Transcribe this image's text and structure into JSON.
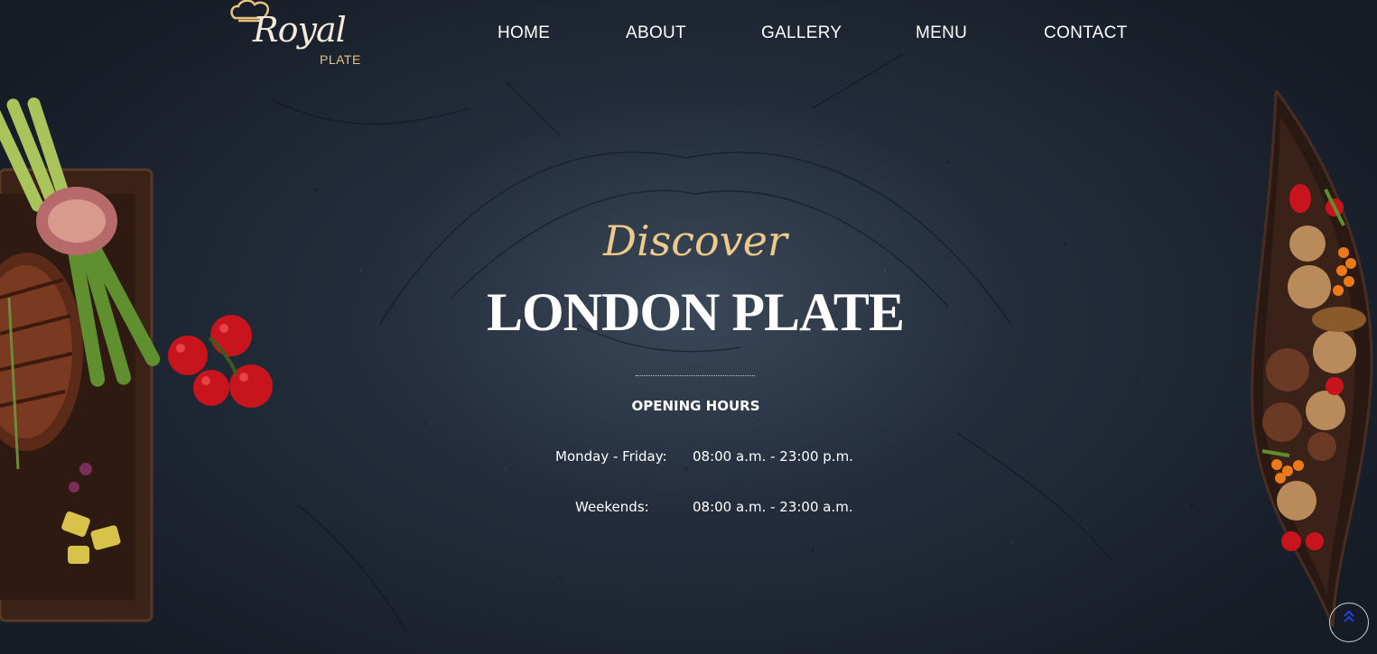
{
  "brand": {
    "script": "Royal",
    "sub": "PLATE",
    "accent_color": "#e9c27c"
  },
  "nav": {
    "items": [
      {
        "label": "HOME"
      },
      {
        "label": "ABOUT"
      },
      {
        "label": "GALLERY"
      },
      {
        "label": "MENU"
      },
      {
        "label": "CONTACT"
      }
    ]
  },
  "hero": {
    "eyebrow": "Discover",
    "title": "LONDON PLATE",
    "hours_title": "OPENING HOURS",
    "hours": [
      {
        "label": "Monday - Friday:",
        "value": "08:00 a.m. - 23:00 p.m."
      },
      {
        "label": "Weekends:",
        "value": "08:00 a.m. - 23:00 a.m."
      }
    ]
  },
  "back_to_top": {
    "icon": "double-chevron-up-icon",
    "glyph": "⌃"
  }
}
